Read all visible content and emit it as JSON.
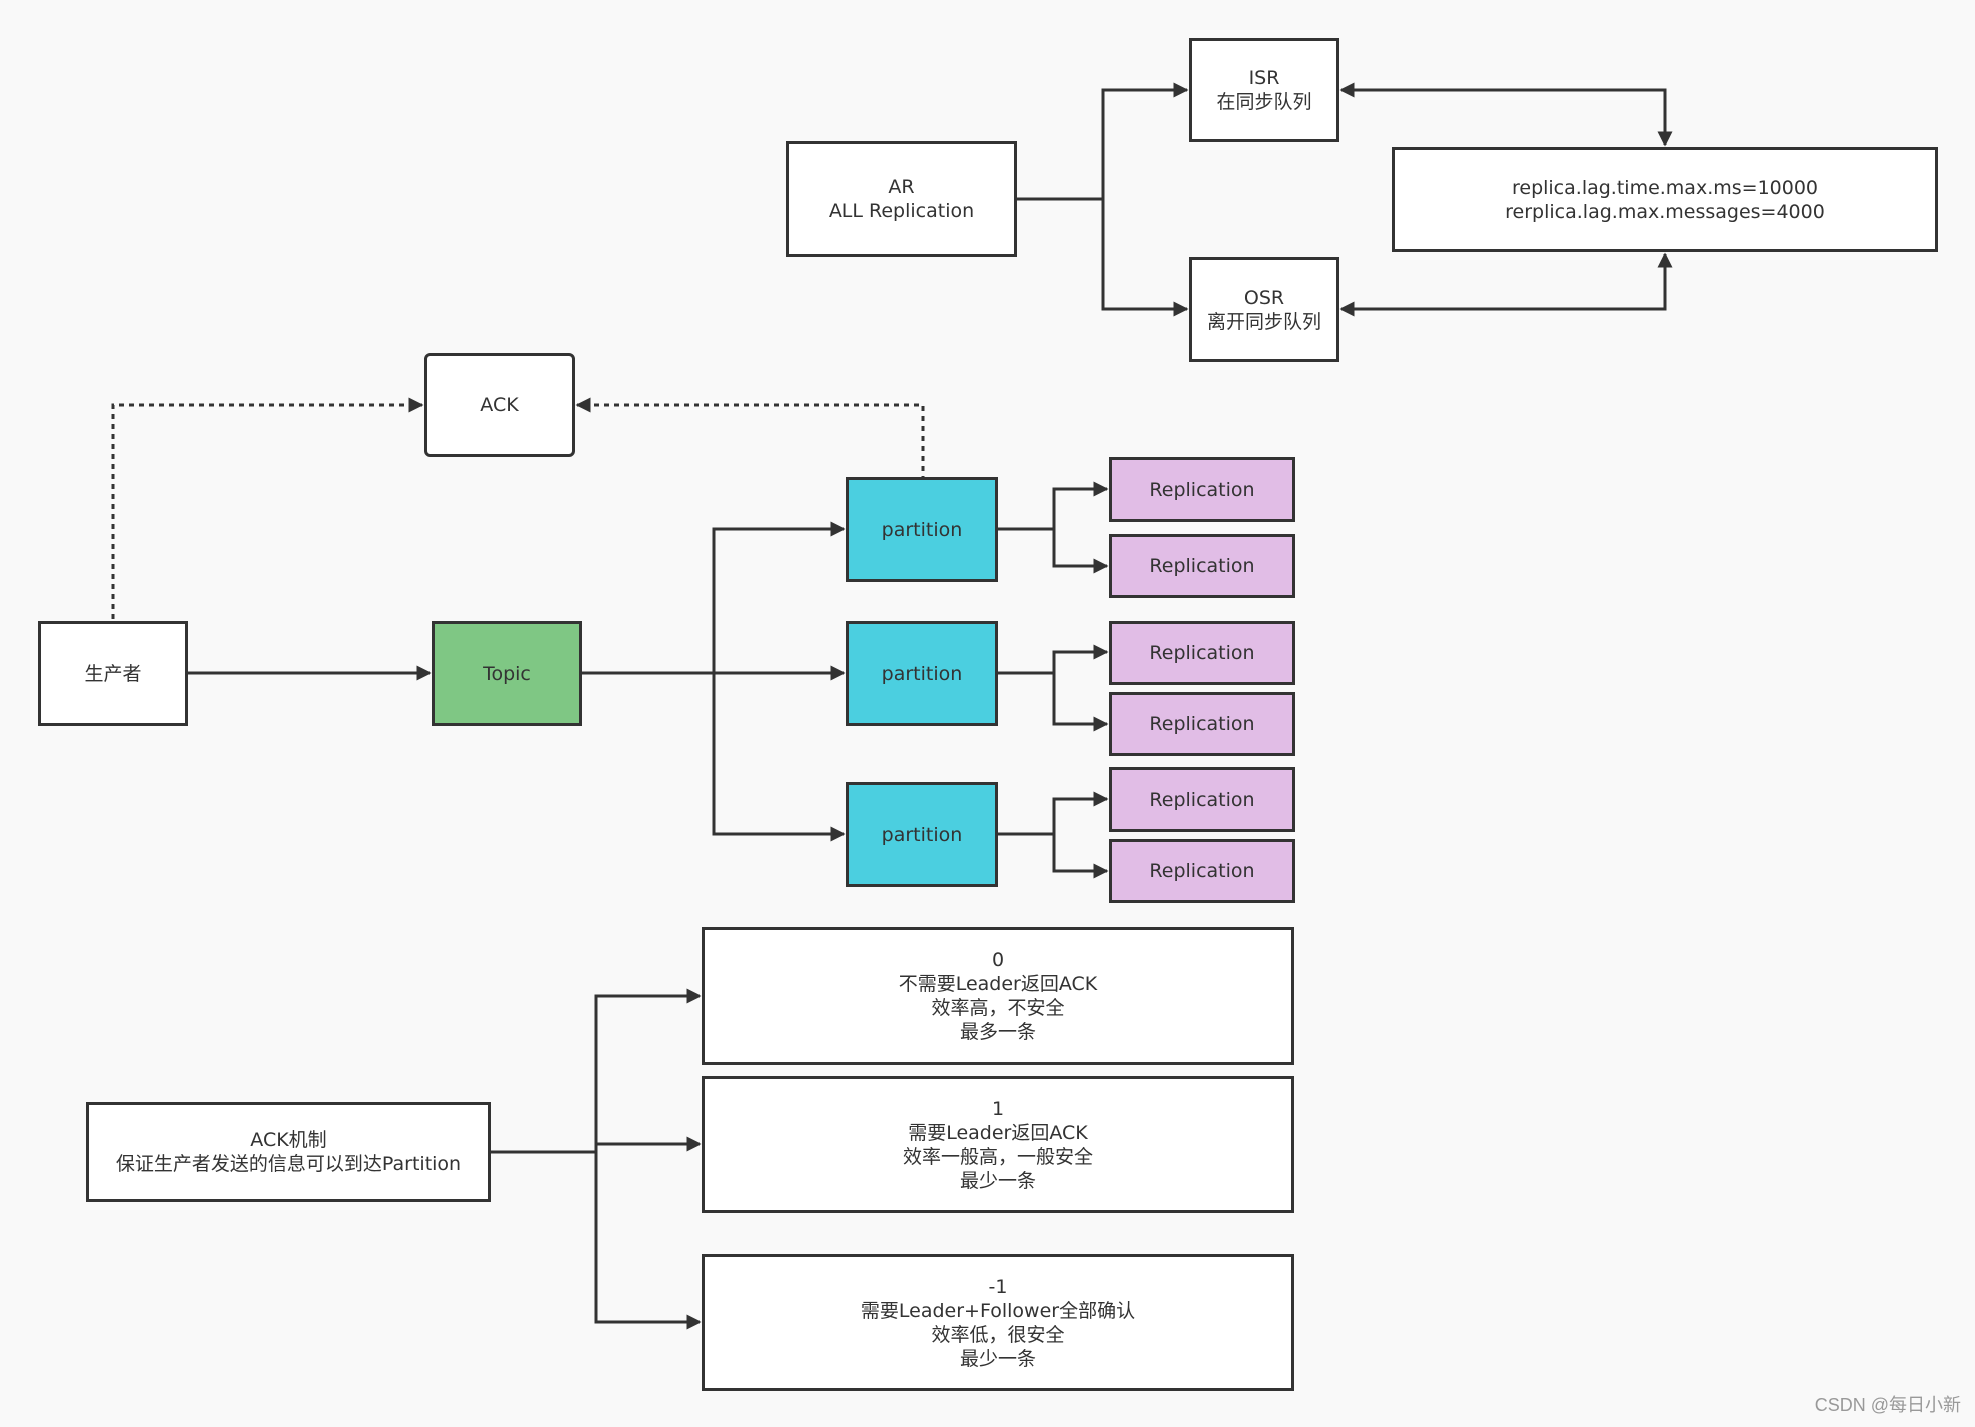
{
  "colors": {
    "stroke": "#333333",
    "background": "#f9f9f9",
    "node_fill": "#ffffff",
    "topic_fill": "#7fc784",
    "partition_fill": "#4bcfe0",
    "replication_fill": "#e1bde6"
  },
  "replica_section": {
    "ar": {
      "lines": [
        "AR",
        "ALL Replication"
      ]
    },
    "isr": {
      "lines": [
        "ISR",
        "在同步队列"
      ]
    },
    "osr": {
      "lines": [
        "OSR",
        "离开同步队列"
      ]
    },
    "config": {
      "lines": [
        "replica.lag.time.max.ms=10000",
        "rerplica.lag.max.messages=4000"
      ]
    }
  },
  "flow_section": {
    "ack": {
      "label": "ACK"
    },
    "producer": {
      "label": "生产者"
    },
    "topic": {
      "label": "Topic"
    },
    "partitions": [
      {
        "label": "partition",
        "replications": [
          "Replication",
          "Replication"
        ]
      },
      {
        "label": "partition",
        "replications": [
          "Replication",
          "Replication"
        ]
      },
      {
        "label": "partition",
        "replications": [
          "Replication",
          "Replication"
        ]
      }
    ]
  },
  "ack_section": {
    "mechanism": {
      "lines": [
        "ACK机制",
        "保证生产者发送的信息可以到达Partition"
      ]
    },
    "options": [
      {
        "lines": [
          "0",
          "不需要Leader返回ACK",
          "效率高，不安全",
          "最多一条"
        ]
      },
      {
        "lines": [
          "1",
          "需要Leader返回ACK",
          "效率一般高，一般安全",
          "最少一条"
        ]
      },
      {
        "lines": [
          "-1",
          "需要Leader+Follower全部确认",
          "效率低，很安全",
          "最少一条"
        ]
      }
    ]
  },
  "watermark": "CSDN @每日小新"
}
